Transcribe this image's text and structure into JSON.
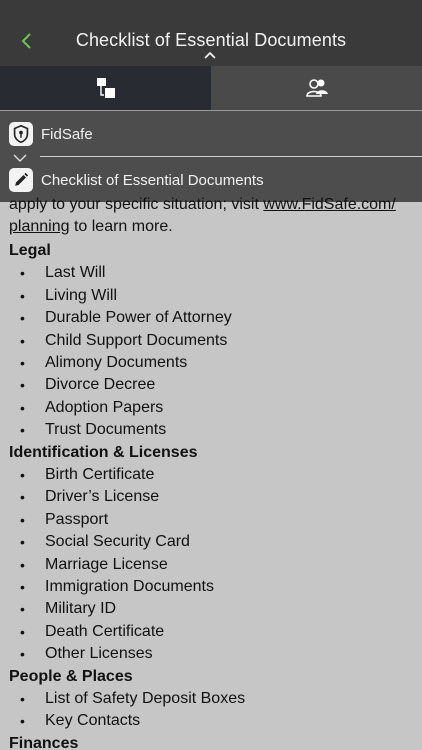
{
  "header": {
    "title": "Checklist of Essential Documents"
  },
  "tabs": [
    {
      "name": "documents",
      "icon": "documents-icon"
    },
    {
      "name": "contacts",
      "icon": "contacts-icon"
    }
  ],
  "dropdown": {
    "items": [
      {
        "label": "FidSafe",
        "icon": "fidsafe-lock-icon"
      },
      {
        "label": "Checklist of Essential Documents",
        "icon": "pencil-icon"
      }
    ]
  },
  "content": {
    "intro_line1": "apply to your specific situation; visit ",
    "intro_link1": "www.FidSafe.com/",
    "intro_link2": "planning",
    "intro_line2": " to learn more.",
    "sections": [
      {
        "title": "Legal",
        "items": [
          "Last Will",
          "Living Will",
          "Durable Power of Attorney",
          "Child Support Documents",
          "Alimony Documents",
          "Divorce Decree",
          "Adoption Papers",
          "Trust Documents"
        ]
      },
      {
        "title": "Identification & Licenses",
        "items": [
          "Birth Certificate",
          "Driver’s License",
          "Passport",
          "Social Security Card",
          "Marriage License",
          "Immigration Documents",
          "Military ID",
          "Death Certificate",
          "Other Licenses"
        ]
      },
      {
        "title": "People & Places",
        "items": [
          "List of Safety Deposit Boxes",
          "Key Contacts"
        ]
      },
      {
        "title": "Finances",
        "items": []
      }
    ]
  },
  "colors": {
    "header_bg": "#3a3a3a",
    "accent_green": "#6fc25a",
    "content_bg": "#c6c6c6"
  }
}
